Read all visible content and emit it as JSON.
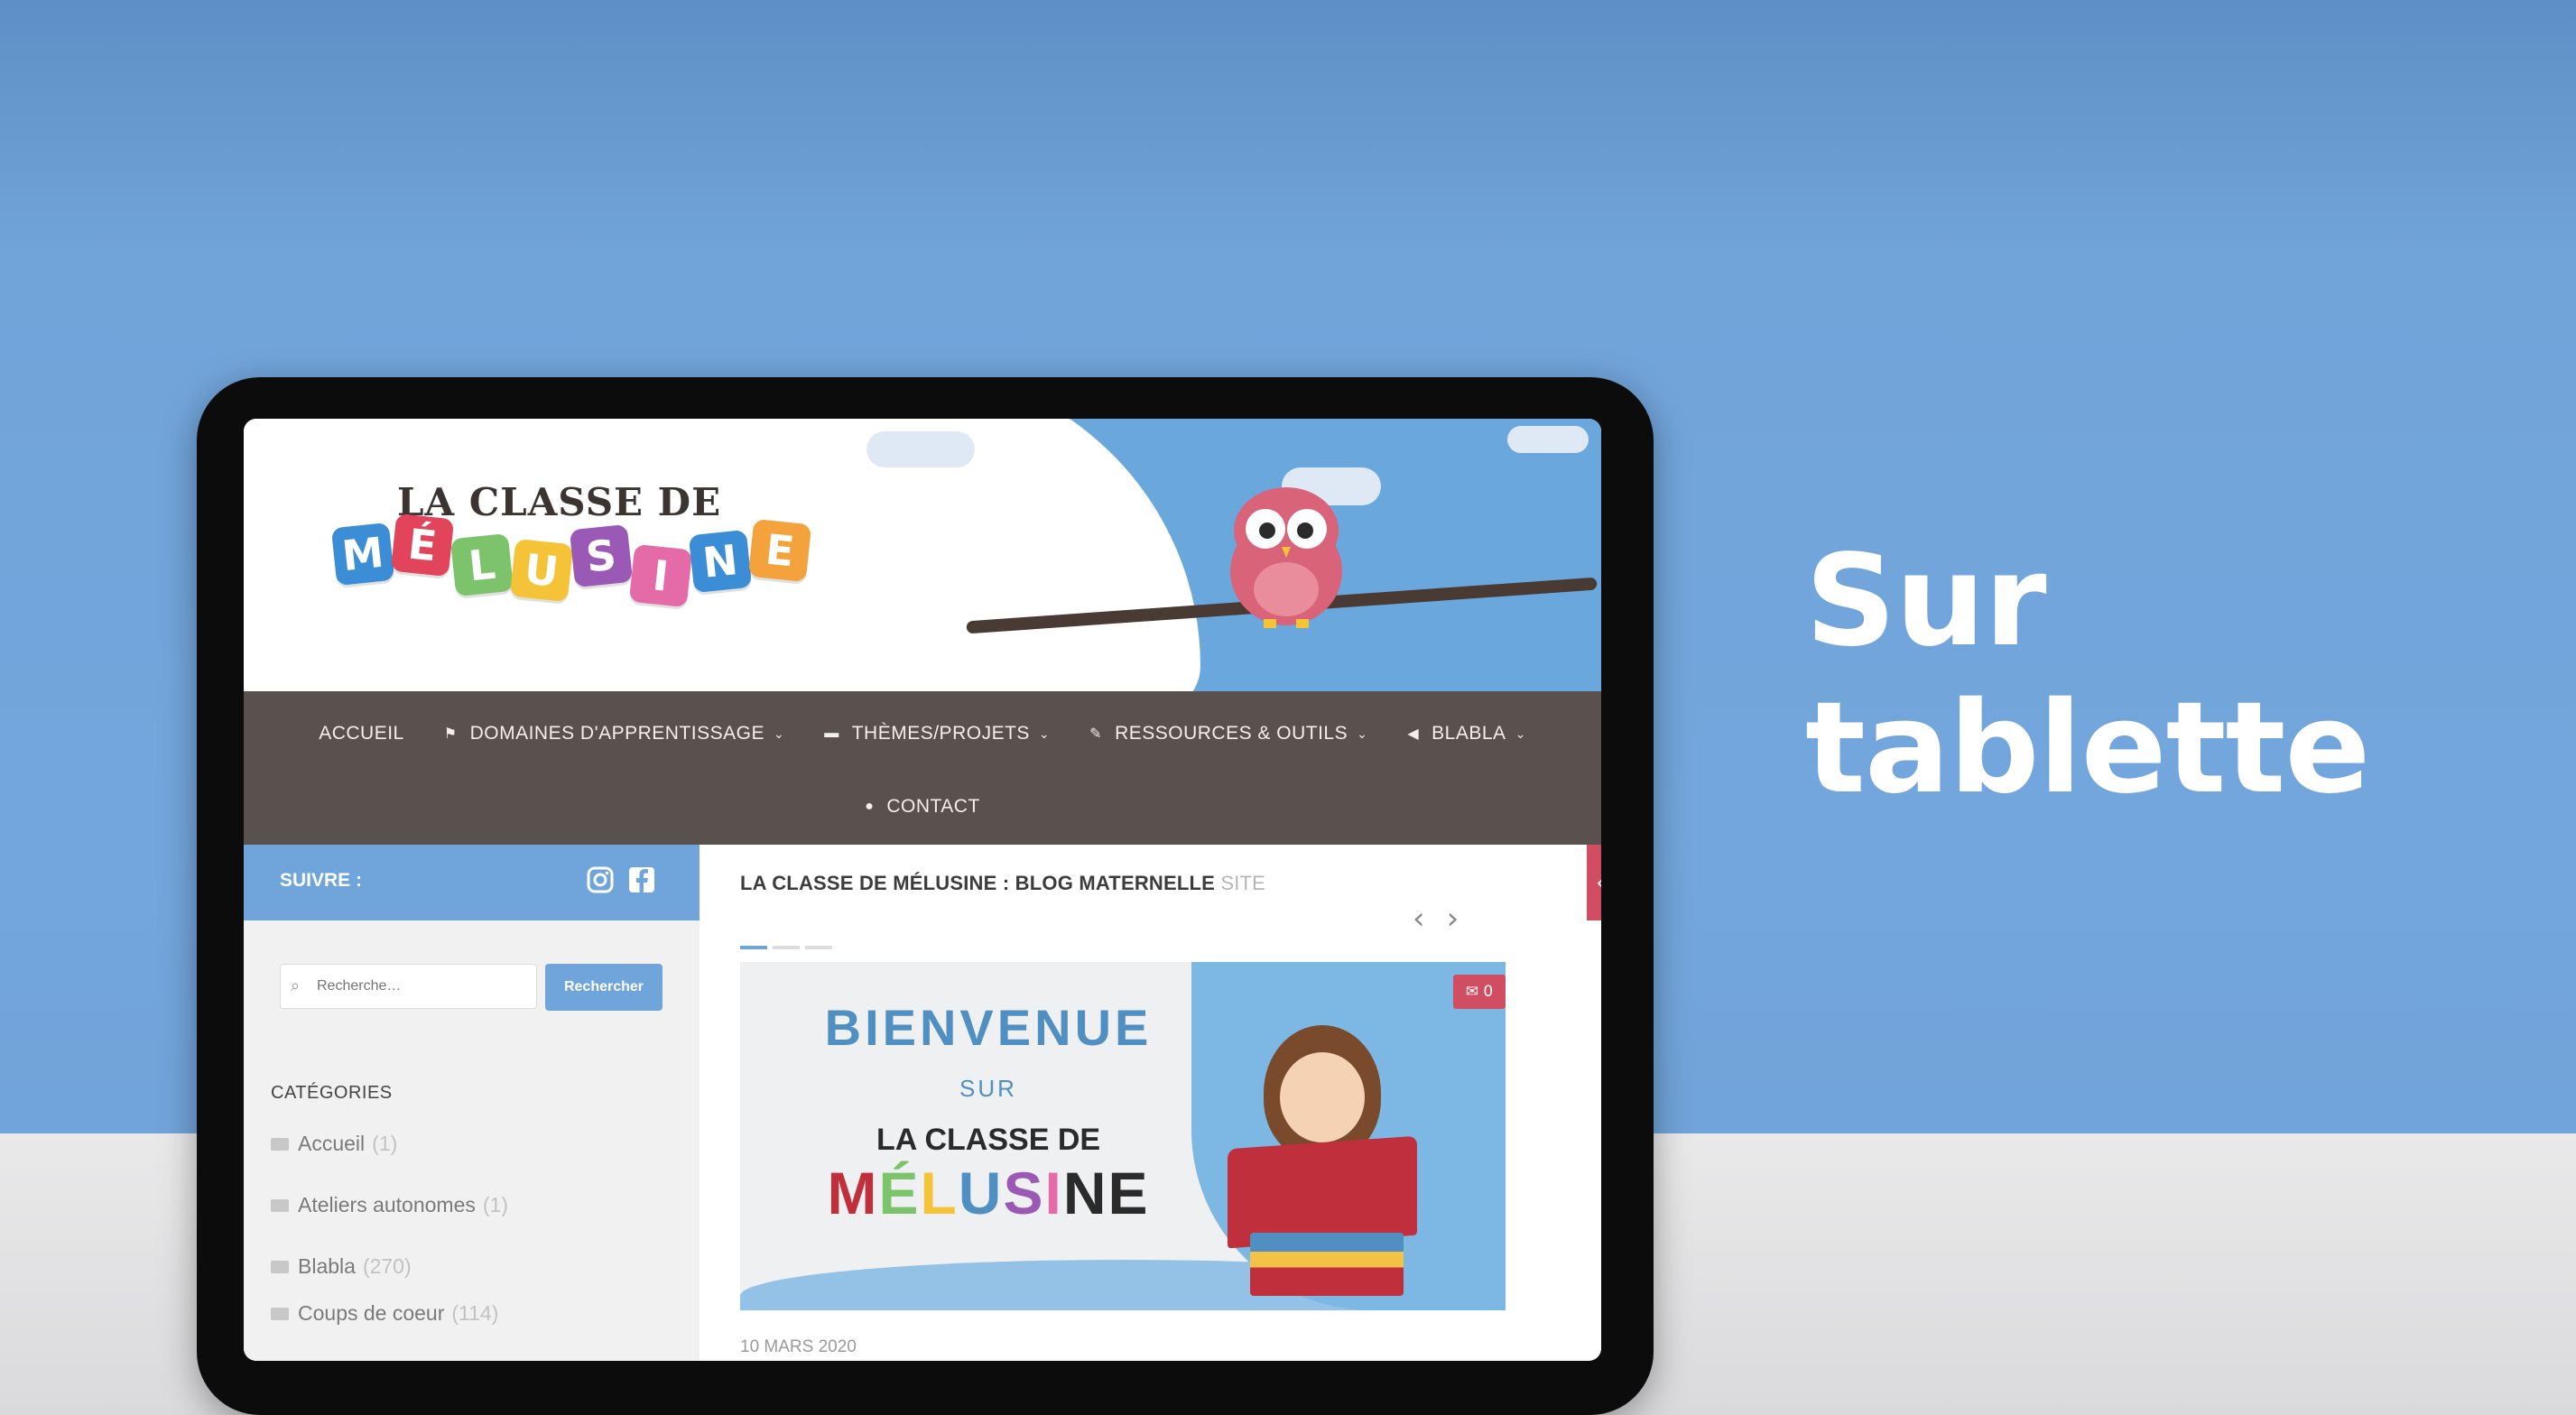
{
  "overlay": {
    "title": "Sur tablette"
  },
  "site": {
    "logo": {
      "top": "LA CLASSE DE",
      "letters": [
        {
          "ch": "M",
          "color": "#3b8ed6"
        },
        {
          "ch": "É",
          "color": "#e2445c"
        },
        {
          "ch": "L",
          "color": "#7cc36b"
        },
        {
          "ch": "U",
          "color": "#f4c338"
        },
        {
          "ch": "S",
          "color": "#9b59b6"
        },
        {
          "ch": "I",
          "color": "#e56ba8"
        },
        {
          "ch": "N",
          "color": "#3b8ed6"
        },
        {
          "ch": "E",
          "color": "#f3a23c"
        }
      ]
    },
    "nav": {
      "accueil": "ACCUEIL",
      "domaines": "DOMAINES D'APPRENTISSAGE",
      "themes": "THÈMES/PROJETS",
      "ressources": "RESSOURCES & OUTILS",
      "blabla": "BLABLA",
      "contact": "CONTACT"
    },
    "sidebar": {
      "follow_label": "SUIVRE :",
      "search_placeholder": "Recherche…",
      "search_button": "Rechercher",
      "categories_title": "CATÉGORIES",
      "categories": [
        {
          "name": "Accueil",
          "count": "(1)"
        },
        {
          "name": "Ateliers autonomes",
          "count": "(1)"
        },
        {
          "name": "Blabla",
          "count": "(270)"
        },
        {
          "name": "Coups de coeur",
          "count": "(114)"
        }
      ]
    },
    "main": {
      "title": "LA CLASSE DE MÉLUSINE : BLOG MATERNELLE",
      "title_suffix": "SITE",
      "feature": {
        "line1": "BIENVENUE",
        "line2": "SUR",
        "line3": "LA CLASSE DE",
        "line4_letters": [
          {
            "ch": "M",
            "color": "#c0303c"
          },
          {
            "ch": "É",
            "color": "#7cc36b"
          },
          {
            "ch": "L",
            "color": "#f4c338"
          },
          {
            "ch": "U",
            "color": "#4f8fc2"
          },
          {
            "ch": "S",
            "color": "#9b59b6"
          },
          {
            "ch": "I",
            "color": "#e56ba8"
          },
          {
            "ch": "N",
            "color": "#2b2b2b"
          },
          {
            "ch": "E",
            "color": "#2b2b2b"
          }
        ],
        "comment_count": "0"
      },
      "date": "10 MARS 2020"
    }
  }
}
